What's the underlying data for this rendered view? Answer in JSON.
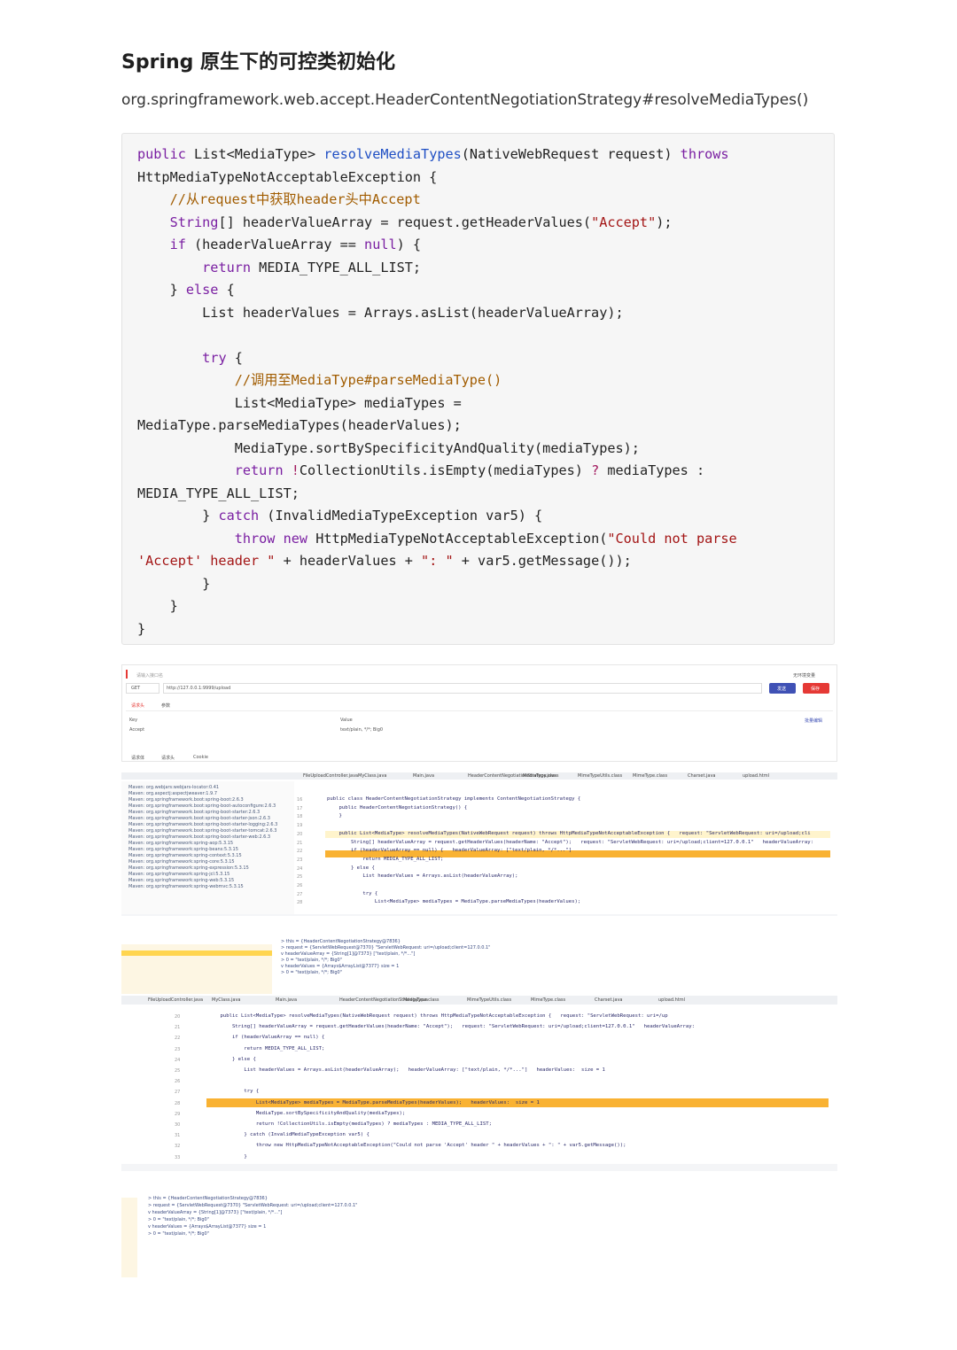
{
  "heading": "Spring 原生下的可控类初始化",
  "subheading": "org.springframework.web.accept.HeaderContentNegotiationStrategy#resolveMediaTypes()",
  "code_lines": [
    [
      [
        "kw",
        "public "
      ],
      [
        "",
        "List<MediaType> "
      ],
      [
        "fn",
        "resolveMediaTypes"
      ],
      [
        "",
        "(NativeWebRequest request) "
      ],
      [
        "kw",
        "throws"
      ]
    ],
    [
      [
        "",
        "HttpMediaTypeNotAcceptableException {"
      ]
    ],
    [
      [
        "",
        "    "
      ],
      [
        "cm",
        "//从request中获取header头中Accept"
      ]
    ],
    [
      [
        "",
        "    "
      ],
      [
        "kw",
        "String"
      ],
      [
        "",
        "[] headerValueArray = request.getHeaderValues("
      ],
      [
        "str",
        "\"Accept\""
      ],
      [
        "",
        ");"
      ]
    ],
    [
      [
        "",
        "    "
      ],
      [
        "kw",
        "if"
      ],
      [
        "",
        " (headerValueArray == "
      ],
      [
        "kw",
        "null"
      ],
      [
        "",
        ") {"
      ]
    ],
    [
      [
        "",
        "        "
      ],
      [
        "kw",
        "return"
      ],
      [
        "",
        " MEDIA_TYPE_ALL_LIST;"
      ]
    ],
    [
      [
        "",
        "    } "
      ],
      [
        "kw",
        "else"
      ],
      [
        "",
        " {"
      ]
    ],
    [
      [
        "",
        "        List headerValues = Arrays.asList(headerValueArray);"
      ]
    ],
    [
      [
        "",
        ""
      ]
    ],
    [
      [
        "",
        "        "
      ],
      [
        "kw",
        "try"
      ],
      [
        "",
        " {"
      ]
    ],
    [
      [
        "",
        "            "
      ],
      [
        "cm",
        "//调用至MediaType#parseMediaType()"
      ]
    ],
    [
      [
        "",
        "            List<MediaType> mediaTypes ="
      ]
    ],
    [
      [
        "",
        "MediaType.parseMediaTypes(headerValues);"
      ]
    ],
    [
      [
        "",
        "            MediaType.sortBySpecificityAndQuality(mediaTypes);"
      ]
    ],
    [
      [
        "",
        "            "
      ],
      [
        "kw",
        "return"
      ],
      [
        "",
        ""
      ],
      [
        "op",
        " !"
      ],
      [
        "",
        "CollectionUtils.isEmpty(mediaTypes) "
      ],
      [
        "op",
        "?"
      ],
      [
        "",
        " mediaTypes :"
      ]
    ],
    [
      [
        "",
        "MEDIA_TYPE_ALL_LIST;"
      ]
    ],
    [
      [
        "",
        "        } "
      ],
      [
        "kw",
        "catch"
      ],
      [
        "",
        " (InvalidMediaTypeException var5) {"
      ]
    ],
    [
      [
        "",
        "            "
      ],
      [
        "kw",
        "throw"
      ],
      [
        "",
        " "
      ],
      [
        "kw",
        "new"
      ],
      [
        "",
        " HttpMediaTypeNotAcceptableException("
      ],
      [
        "str",
        "\"Could not parse"
      ]
    ],
    [
      [
        "str",
        "'Accept' header \""
      ],
      [
        "",
        " + headerValues + "
      ],
      [
        "str",
        "\": \""
      ],
      [
        "",
        " + var5.getMessage());"
      ]
    ],
    [
      [
        "",
        "        }"
      ]
    ],
    [
      [
        "",
        "    }"
      ]
    ],
    [
      [
        "",
        "}"
      ]
    ]
  ],
  "request_panel": {
    "name_placeholder": "请输入接口名",
    "env": "无环境变量",
    "method": "GET",
    "url": "http://127.0.0.1:9999/upload",
    "send_label": "发送",
    "save_label": "保存",
    "tab_headers": "请求头",
    "tab_params": "参数",
    "col_key": "Key",
    "col_value": "Value",
    "bulk_edit": "批量编辑",
    "row_key": "Accept",
    "row_value": "text/plain, */*; Big0",
    "bottom_tab_body": "请求体",
    "bottom_tab_headers": "请求头",
    "bottom_tab_cookie": "Cookie"
  },
  "ide_top": {
    "file_tabs": [
      "FileUploadController.java",
      "MyClass.java",
      "Main.java",
      "HeaderContentNegotiationStrategy.java",
      "MediaType.class",
      "MimeTypeUtils.class",
      "MimeType.class",
      "Charset.java",
      "upload.html"
    ],
    "gutter": [
      "16",
      "17",
      "18",
      "19",
      "20",
      "21",
      "22",
      "23",
      "24",
      "25",
      "26",
      "27",
      "28"
    ],
    "lines": [
      "public class HeaderContentNegotiationStrategy implements ContentNegotiationStrategy {",
      "    public HeaderContentNegotiationStrategy() {",
      "    }",
      "",
      "    public List<MediaType> resolveMediaTypes(NativeWebRequest request) throws HttpMediaTypeNotAcceptableException {   request: \"ServletWebRequest: uri=/upload;cli",
      "        String[] headerValueArray = request.getHeaderValues(headerName: \"Accept\");   request: \"ServletWebRequest: uri=/upload;client=127.0.0.1\"   headerValueArray:",
      "        if (headerValueArray == null) {   headerValueArray: [\"text/plain, */*...\"]",
      "            return MEDIA_TYPE_ALL_LIST;",
      "        } else {",
      "            List headerValues = Arrays.asList(headerValueArray);",
      "",
      "            try {",
      "                List<MediaType> mediaTypes = MediaType.parseMediaTypes(headerValues);"
    ],
    "tree_items": [
      "Maven: org.webjars:webjars-locator:0.41",
      "Maven: org.aspectj:aspectjweaver:1.9.7",
      "Maven: org.springframework.boot:spring-boot:2.6.3",
      "Maven: org.springframework.boot:spring-boot-autoconfigure:2.6.3",
      "Maven: org.springframework.boot:spring-boot-starter:2.6.3",
      "Maven: org.springframework.boot:spring-boot-starter-json:2.6.3",
      "Maven: org.springframework.boot:spring-boot-starter-logging:2.6.3",
      "Maven: org.springframework.boot:spring-boot-starter-tomcat:2.6.3",
      "Maven: org.springframework.boot:spring-boot-starter-web:2.6.3",
      "Maven: org.springframework:spring-aop:5.3.15",
      "Maven: org.springframework:spring-beans:5.3.15",
      "Maven: org.springframework:spring-context:5.3.15",
      "Maven: org.springframework:spring-core:5.3.15",
      "Maven: org.springframework:spring-expression:5.3.15",
      "Maven: org.springframework:spring-jcl:5.3.15",
      "Maven: org.springframework:spring-web:5.3.15",
      "Maven: org.springframework:spring-webmvc:5.3.15"
    ]
  },
  "ide_bottom": {
    "gutter": [
      "20",
      "21",
      "22",
      "23",
      "24",
      "25",
      "26",
      "27",
      "28",
      "29",
      "30",
      "31",
      "32",
      "33"
    ],
    "lines": [
      "    public List<MediaType> resolveMediaTypes(NativeWebRequest request) throws HttpMediaTypeNotAcceptableException {   request: \"ServletWebRequest: uri=/up",
      "        String[] headerValueArray = request.getHeaderValues(headerName: \"Accept\");   request: \"ServletWebRequest: uri=/upload;client=127.0.0.1\"   headerValueArray:",
      "        if (headerValueArray == null) {",
      "            return MEDIA_TYPE_ALL_LIST;",
      "        } else {",
      "            List headerValues = Arrays.asList(headerValueArray);   headerValueArray: [\"text/plain, */*...\"]   headerValues:  size = 1",
      "",
      "            try {",
      "                List<MediaType> mediaTypes = MediaType.parseMediaTypes(headerValues);   headerValues:  size = 1",
      "                MediaType.sortBySpecificityAndQuality(mediaTypes);",
      "                return !CollectionUtils.isEmpty(mediaTypes) ? mediaTypes : MEDIA_TYPE_ALL_LIST;",
      "            } catch (InvalidMediaTypeException var5) {",
      "                throw new HttpMediaTypeNotAcceptableException(\"Could not parse 'Accept' header \" + headerValues + \": \" + var5.getMessage());",
      "            }"
    ],
    "variables": [
      "> this = {HeaderContentNegotiationStrategy@7836}",
      "> request = {ServletWebRequest@7370} \"ServletWebRequest: uri=/upload;client=127.0.0.1\"",
      "v headerValueArray = {String[1]@7373} [\"text/plain, */*...\"]",
      "    > 0 = \"text/plain, */*; Big0\"",
      "v headerValues = {Arrays$ArrayList@7377}  size = 1",
      "    > 0 = \"text/plain, */*; Big0\""
    ]
  }
}
